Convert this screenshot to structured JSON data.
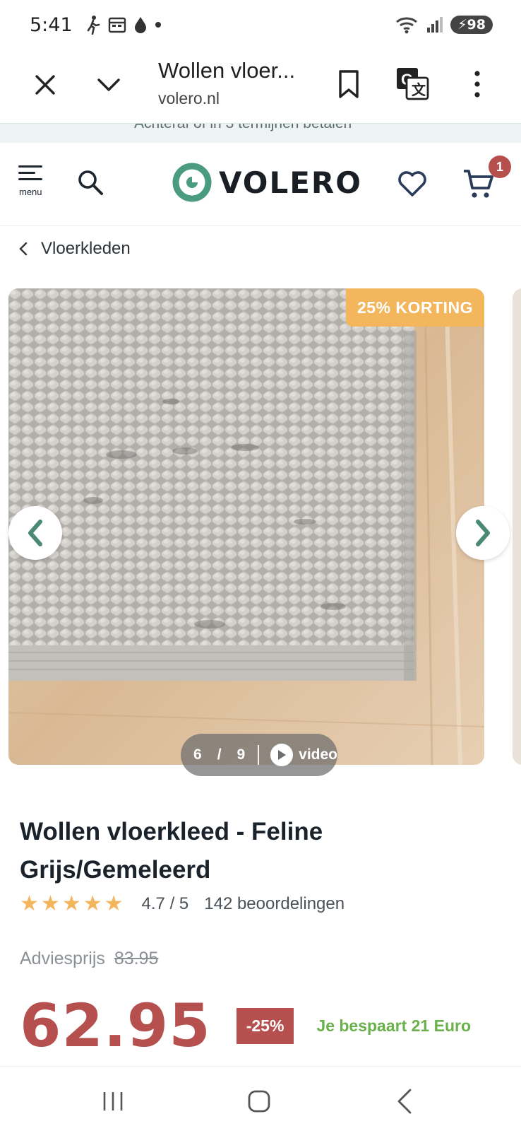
{
  "status_bar": {
    "time": "5:41",
    "battery": "98",
    "icons": [
      "walking-icon",
      "calendar-icon",
      "drop-icon",
      "dot-icon",
      "wifi-icon",
      "signal-icon",
      "battery-icon"
    ]
  },
  "browser": {
    "title": "Wollen vloer...",
    "url": "volero.nl",
    "icons": [
      "close-icon",
      "chevron-down-icon",
      "bookmark-icon",
      "translate-icon",
      "more-vert-icon"
    ]
  },
  "promo_strip": {
    "text": "Achteraf of in 3 termijnen betalen"
  },
  "header": {
    "menu_label": "menu",
    "logo_text": "VOLERO",
    "cart_count": "1",
    "colors": {
      "brand_green": "#4a9b7f",
      "accent_red": "#b5504f"
    }
  },
  "breadcrumb": {
    "label": "Vloerkleden"
  },
  "gallery": {
    "discount_badge": "25% KORTING",
    "current": "6",
    "separator": "/",
    "total": "9",
    "video_label": "video"
  },
  "product": {
    "title": "Wollen vloerkleed - Feline Grijs/Gemeleerd",
    "rating_stars": 4.7,
    "rating_text": "4.7 / 5",
    "reviews": "142 beoordelingen",
    "advice_label": "Adviesprijs",
    "advice_price": "83.95",
    "price": "62.95",
    "discount_pct": "-25%",
    "savings": "Je bespaart 21 Euro"
  },
  "nav": {
    "icons": [
      "recent-apps-icon",
      "home-icon",
      "back-icon"
    ]
  }
}
